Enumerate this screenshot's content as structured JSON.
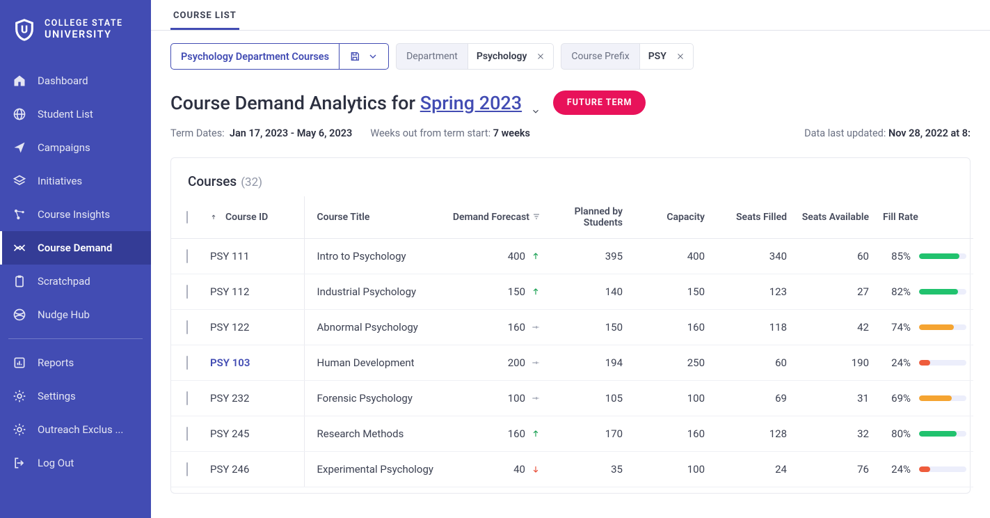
{
  "brand": {
    "line1": "COLLEGE STATE",
    "line2": "UNIVERSITY"
  },
  "sidebar": {
    "items": [
      {
        "label": "Dashboard",
        "icon": "home-icon"
      },
      {
        "label": "Student List",
        "icon": "globe-icon"
      },
      {
        "label": "Campaigns",
        "icon": "send-icon"
      },
      {
        "label": "Initiatives",
        "icon": "layers-icon"
      },
      {
        "label": "Course Insights",
        "icon": "nodes-icon"
      },
      {
        "label": "Course Demand",
        "icon": "trend-icon",
        "active": true
      },
      {
        "label": "Scratchpad",
        "icon": "clipboard-icon"
      },
      {
        "label": "Nudge Hub",
        "icon": "ball-icon"
      }
    ],
    "items2": [
      {
        "label": "Reports",
        "icon": "chart-icon"
      },
      {
        "label": "Settings",
        "icon": "gear-icon"
      },
      {
        "label": "Outreach Exclus ...",
        "icon": "gear-icon"
      },
      {
        "label": "Log Out",
        "icon": "logout-icon"
      }
    ]
  },
  "tabs": {
    "active": "COURSE LIST"
  },
  "filters": {
    "saved": "Psychology Department Courses",
    "chips": [
      {
        "label": "Department",
        "value": "Psychology"
      },
      {
        "label": "Course Prefix",
        "value": "PSY"
      }
    ]
  },
  "header": {
    "title_prefix": "Course Demand Analytics for ",
    "term": "Spring 2023",
    "badge": "FUTURE TERM",
    "dates_label": "Term Dates:",
    "dates_value": "Jan 17, 2023 -  May 6, 2023",
    "weeks_label": "Weeks out from term start:",
    "weeks_value": "7 weeks",
    "updated_label": "Data last updated:",
    "updated_value": "Nov 28, 2022 at 8:"
  },
  "table": {
    "title": "Courses",
    "count": "(32)",
    "columns": {
      "id": "Course ID",
      "title": "Course Title",
      "demand": "Demand Forecast",
      "planned": "Planned by Students",
      "capacity": "Capacity",
      "filled": "Seats Filled",
      "avail": "Seats Available",
      "fill": "Fill Rate"
    },
    "rows": [
      {
        "id": "PSY 111",
        "title": "Intro to Psychology",
        "demand": 400,
        "trend": "up",
        "planned": 395,
        "capacity": 400,
        "filled": 340,
        "avail": 60,
        "fill": 85,
        "color": "g"
      },
      {
        "id": "PSY 112",
        "title": "Industrial Psychology",
        "demand": 150,
        "trend": "up",
        "planned": 140,
        "capacity": 150,
        "filled": 123,
        "avail": 27,
        "fill": 82,
        "color": "g"
      },
      {
        "id": "PSY 122",
        "title": "Abnormal Psychology",
        "demand": 160,
        "trend": "flat",
        "planned": 150,
        "capacity": 160,
        "filled": 118,
        "avail": 42,
        "fill": 74,
        "color": "o"
      },
      {
        "id": "PSY 103",
        "title": "Human Development",
        "demand": 200,
        "trend": "flat",
        "planned": 194,
        "capacity": 250,
        "filled": 60,
        "avail": 190,
        "fill": 24,
        "color": "r",
        "highlight": true
      },
      {
        "id": "PSY 232",
        "title": "Forensic Psychology",
        "demand": 100,
        "trend": "flat",
        "planned": 105,
        "capacity": 100,
        "filled": 69,
        "avail": 31,
        "fill": 69,
        "color": "o"
      },
      {
        "id": "PSY 245",
        "title": "Research Methods",
        "demand": 160,
        "trend": "up",
        "planned": 170,
        "capacity": 160,
        "filled": 128,
        "avail": 32,
        "fill": 80,
        "color": "g"
      },
      {
        "id": "PSY 246",
        "title": "Experimental Psychology",
        "demand": 40,
        "trend": "down",
        "planned": 35,
        "capacity": 100,
        "filled": 24,
        "avail": 76,
        "fill": 24,
        "color": "r"
      }
    ]
  }
}
